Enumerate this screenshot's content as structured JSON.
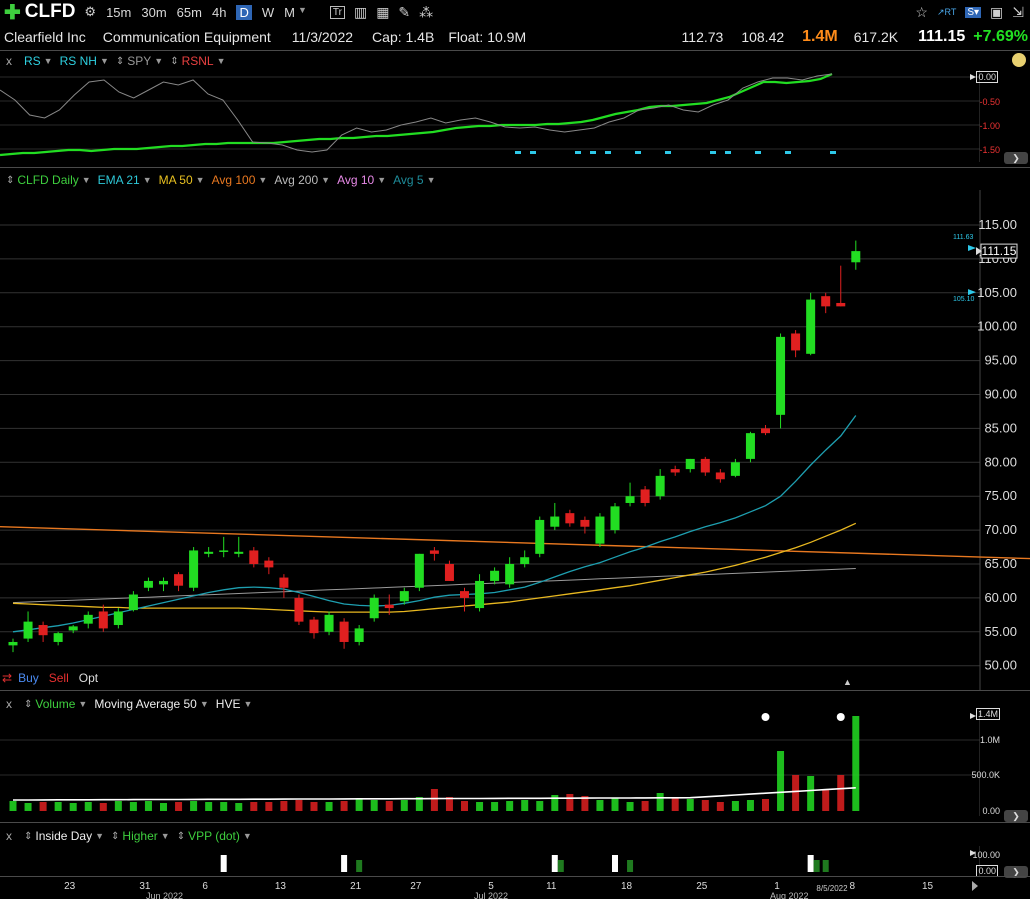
{
  "toolbar": {
    "symbol": "CLFD",
    "intervals": [
      "15m",
      "30m",
      "65m",
      "4h",
      "D",
      "W",
      "M"
    ],
    "active_interval": "D"
  },
  "header": {
    "company": "Clearfield Inc",
    "industry": "Communication Equipment",
    "date": "11/3/2022",
    "cap": "Cap: 1.4B",
    "float": "Float: 10.9M",
    "high": "112.73",
    "low": "108.42",
    "volume": "1.4M",
    "avg_volume": "617.2K",
    "last": "111.15",
    "change": "+7.69%"
  },
  "rs_panel": {
    "items": [
      "RS",
      "RS NH",
      "SPY",
      "RSNL"
    ],
    "close_label": "x",
    "axis": [
      "0.00",
      "-0.50",
      "-1.00",
      "-1.50"
    ]
  },
  "price_panel": {
    "items": [
      "CLFD Daily",
      "EMA 21",
      "MA 50",
      "Avg 100",
      "Avg 200",
      "Avg 10",
      "Avg 5"
    ],
    "axis": [
      "115.00",
      "110.00",
      "105.00",
      "100.00",
      "95.00",
      "90.00",
      "85.00",
      "80.00",
      "75.00",
      "70.00",
      "65.00",
      "60.00",
      "55.00",
      "50.00"
    ],
    "last_label": "111.15",
    "tag_high": "111.63",
    "tag_low": "105.10",
    "trade": {
      "buy": "Buy",
      "sell": "Sell",
      "opt": "Opt"
    }
  },
  "volume_panel": {
    "items": [
      "Volume",
      "Moving Average 50",
      "HVE"
    ],
    "close_label": "x",
    "axis": [
      "1.4M",
      "1.0M",
      "500.0K",
      "0.00"
    ]
  },
  "pattern_panel": {
    "items": [
      "Inside Day",
      "Higher",
      "VPP (dot)"
    ],
    "close_label": "x",
    "axis": [
      "100.00",
      "0.00"
    ]
  },
  "xaxis": {
    "ticks": [
      "23",
      "31",
      "6",
      "13",
      "21",
      "27",
      "5",
      "11",
      "18",
      "25",
      "1",
      "8",
      "15"
    ],
    "months": [
      "Jun 2022",
      "Jul 2022",
      "Aug 2022"
    ],
    "current_date": "8/5/2022"
  },
  "colors": {
    "up": "#22dd22",
    "down": "#e02020",
    "ema21": "#1e9fb0",
    "ma50": "#e8b820",
    "avg100": "#e87820",
    "avg200": "#9a9a9a",
    "accent_orange": "#ff8c1a",
    "change_green": "#22e022"
  },
  "chart_data": {
    "type": "candlestick",
    "title": "CLFD Daily",
    "ylim": [
      48,
      118
    ],
    "candles": [
      {
        "o": 53,
        "h": 54,
        "l": 52,
        "c": 53.5
      },
      {
        "o": 54,
        "h": 58,
        "l": 53.5,
        "c": 56.5
      },
      {
        "o": 56,
        "h": 56.5,
        "l": 53.5,
        "c": 54.5
      },
      {
        "o": 53.5,
        "h": 55,
        "l": 53,
        "c": 54.8
      },
      {
        "o": 55.2,
        "h": 56,
        "l": 54.8,
        "c": 55.8
      },
      {
        "o": 56.2,
        "h": 58,
        "l": 55.5,
        "c": 57.5
      },
      {
        "o": 58,
        "h": 59,
        "l": 55,
        "c": 55.5
      },
      {
        "o": 56,
        "h": 58.5,
        "l": 55.5,
        "c": 58
      },
      {
        "o": 58.2,
        "h": 61,
        "l": 58,
        "c": 60.5
      },
      {
        "o": 61.5,
        "h": 63,
        "l": 61,
        "c": 62.5
      },
      {
        "o": 62,
        "h": 63,
        "l": 61,
        "c": 62.5
      },
      {
        "o": 63.5,
        "h": 63.8,
        "l": 61,
        "c": 61.8
      },
      {
        "o": 61.5,
        "h": 67.5,
        "l": 61,
        "c": 67
      },
      {
        "o": 66.5,
        "h": 67.5,
        "l": 66,
        "c": 66.8
      },
      {
        "o": 67,
        "h": 69,
        "l": 66,
        "c": 67
      },
      {
        "o": 66.5,
        "h": 69,
        "l": 66,
        "c": 66.8
      },
      {
        "o": 67,
        "h": 67.5,
        "l": 64.5,
        "c": 65
      },
      {
        "o": 65.5,
        "h": 66,
        "l": 63.5,
        "c": 64.5
      },
      {
        "o": 63,
        "h": 63.5,
        "l": 60,
        "c": 61.5
      },
      {
        "o": 60,
        "h": 60.5,
        "l": 56,
        "c": 56.5
      },
      {
        "o": 56.8,
        "h": 57.2,
        "l": 54,
        "c": 54.8
      },
      {
        "o": 55,
        "h": 58,
        "l": 54.5,
        "c": 57.5
      },
      {
        "o": 56.5,
        "h": 57,
        "l": 52.5,
        "c": 53.5
      },
      {
        "o": 53.5,
        "h": 56,
        "l": 53,
        "c": 55.5
      },
      {
        "o": 57,
        "h": 60.5,
        "l": 56.5,
        "c": 60
      },
      {
        "o": 59,
        "h": 60.5,
        "l": 57.5,
        "c": 58.5
      },
      {
        "o": 59.5,
        "h": 61.5,
        "l": 59,
        "c": 61
      },
      {
        "o": 61.5,
        "h": 66.5,
        "l": 61,
        "c": 66.5
      },
      {
        "o": 67,
        "h": 67.5,
        "l": 65.5,
        "c": 66.5
      },
      {
        "o": 65,
        "h": 65.5,
        "l": 62.5,
        "c": 62.5
      },
      {
        "o": 61,
        "h": 61.5,
        "l": 58,
        "c": 60
      },
      {
        "o": 58.5,
        "h": 63.5,
        "l": 58,
        "c": 62.5
      },
      {
        "o": 62.5,
        "h": 64.5,
        "l": 62,
        "c": 64
      },
      {
        "o": 62,
        "h": 66,
        "l": 61.5,
        "c": 65
      },
      {
        "o": 65,
        "h": 67,
        "l": 64.5,
        "c": 66
      },
      {
        "o": 66.5,
        "h": 72,
        "l": 66,
        "c": 71.5
      },
      {
        "o": 70.5,
        "h": 74,
        "l": 70,
        "c": 72
      },
      {
        "o": 72.5,
        "h": 73,
        "l": 70.5,
        "c": 71
      },
      {
        "o": 71.5,
        "h": 72,
        "l": 69.5,
        "c": 70.5
      },
      {
        "o": 68,
        "h": 72.5,
        "l": 67.5,
        "c": 72
      },
      {
        "o": 70,
        "h": 74,
        "l": 69.5,
        "c": 73.5
      },
      {
        "o": 74,
        "h": 77,
        "l": 73.5,
        "c": 75
      },
      {
        "o": 76,
        "h": 76.5,
        "l": 73.5,
        "c": 74
      },
      {
        "o": 75,
        "h": 79,
        "l": 74.5,
        "c": 78
      },
      {
        "o": 79,
        "h": 79.5,
        "l": 78,
        "c": 78.5
      },
      {
        "o": 79,
        "h": 80.5,
        "l": 78.5,
        "c": 80.5
      },
      {
        "o": 80.5,
        "h": 80.8,
        "l": 78,
        "c": 78.5
      },
      {
        "o": 78.5,
        "h": 79,
        "l": 77,
        "c": 77.5
      },
      {
        "o": 78,
        "h": 80.5,
        "l": 77.8,
        "c": 80
      },
      {
        "o": 80.5,
        "h": 84.5,
        "l": 80,
        "c": 84.3
      },
      {
        "o": 85,
        "h": 85.5,
        "l": 84,
        "c": 84.3
      },
      {
        "o": 87,
        "h": 99,
        "l": 85,
        "c": 98.5
      },
      {
        "o": 99,
        "h": 99.5,
        "l": 95.5,
        "c": 96.5
      },
      {
        "o": 96,
        "h": 105,
        "l": 95.8,
        "c": 104
      },
      {
        "o": 104.5,
        "h": 105,
        "l": 102,
        "c": 103
      },
      {
        "o": 103.5,
        "h": 109,
        "l": 103,
        "c": 103
      },
      {
        "o": 109.5,
        "h": 112.7,
        "l": 108.4,
        "c": 111.15
      }
    ],
    "ema21": [
      55,
      55.3,
      55.6,
      55.9,
      56.3,
      56.8,
      57.3,
      57.8,
      58.3,
      58.8,
      59.3,
      59.8,
      60.3,
      60.8,
      61.2,
      61.5,
      61.6,
      61.5,
      61.3,
      60.8,
      60.2,
      59.6,
      59.1,
      58.9,
      58.8,
      58.9,
      59.2,
      59.6,
      60.1,
      60.4,
      60.5,
      60.6,
      60.8,
      61.2,
      61.6,
      62.3,
      63.1,
      63.9,
      64.6,
      65.2,
      66,
      66.8,
      67.5,
      68.3,
      69,
      69.8,
      70.5,
      71.1,
      71.8,
      72.7,
      73.6,
      75,
      77.2,
      79.6,
      81.8,
      83.9,
      86.9
    ],
    "ma50": [
      59.2,
      59.1,
      59,
      58.9,
      58.8,
      58.7,
      58.6,
      58.6,
      58.5,
      58.5,
      58.5,
      58.5,
      58.5,
      58.5,
      58.5,
      58.5,
      58.4,
      58.3,
      58.2,
      58.1,
      58,
      57.9,
      57.9,
      57.9,
      57.9,
      57.9,
      58,
      58.2,
      58.4,
      58.6,
      58.8,
      59,
      59.2,
      59.4,
      59.7,
      60,
      60.3,
      60.6,
      60.9,
      61.2,
      61.5,
      61.8,
      62.2,
      62.6,
      63,
      63.4,
      63.8,
      64.3,
      64.8,
      65.4,
      66,
      66.7,
      67.4,
      68.2,
      69.1,
      70,
      71
    ]
  }
}
